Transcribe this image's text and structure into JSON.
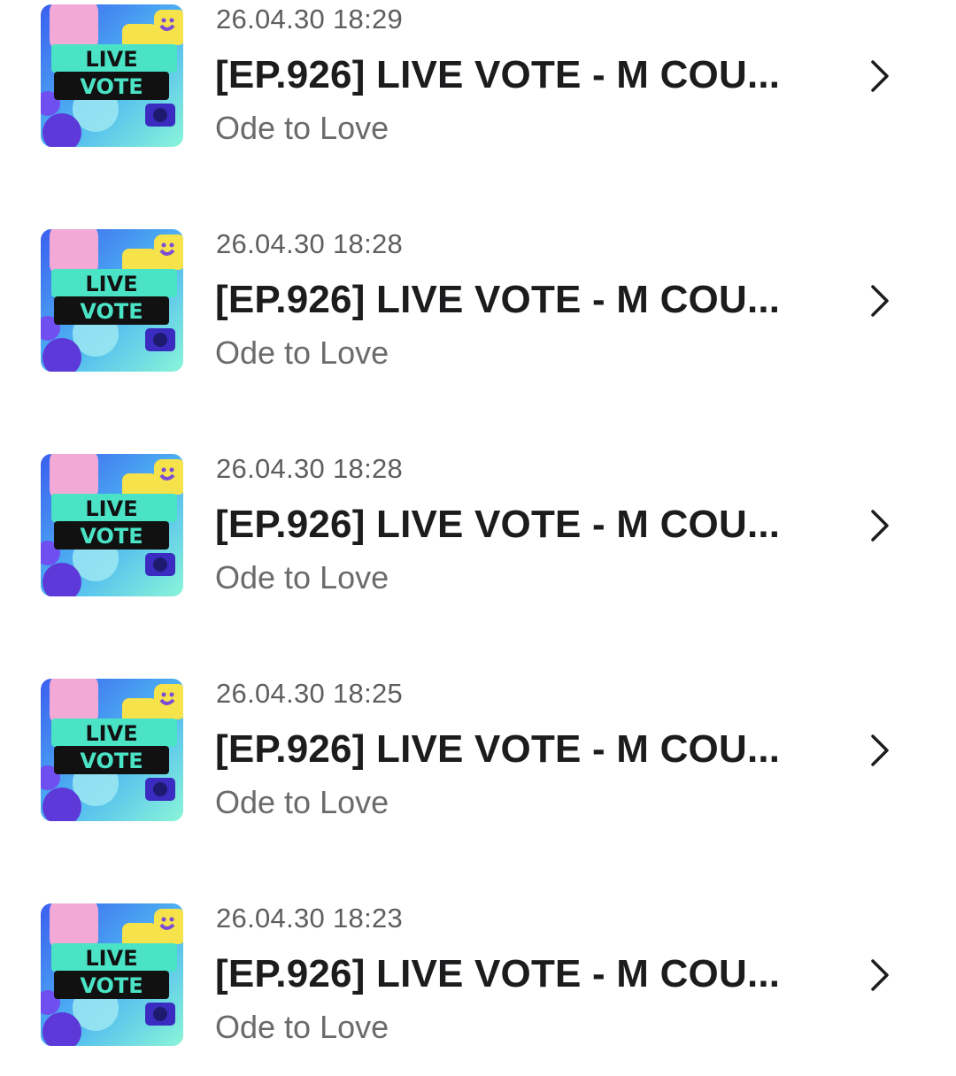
{
  "items": [
    {
      "timestamp": "26.04.30 18:29",
      "title": "[EP.926] LIVE VOTE - M COU...",
      "song": "Ode to Love",
      "thumb_line1": "LIVE",
      "thumb_line2": "VOTE",
      "thumb_icon": "live-vote-thumbnail",
      "arrow_icon": "chevron-right-icon"
    },
    {
      "timestamp": "26.04.30 18:28",
      "title": "[EP.926] LIVE VOTE - M COU...",
      "song": "Ode to Love",
      "thumb_line1": "LIVE",
      "thumb_line2": "VOTE",
      "thumb_icon": "live-vote-thumbnail",
      "arrow_icon": "chevron-right-icon"
    },
    {
      "timestamp": "26.04.30 18:28",
      "title": "[EP.926] LIVE VOTE - M COU...",
      "song": "Ode to Love",
      "thumb_line1": "LIVE",
      "thumb_line2": "VOTE",
      "thumb_icon": "live-vote-thumbnail",
      "arrow_icon": "chevron-right-icon"
    },
    {
      "timestamp": "26.04.30 18:25",
      "title": "[EP.926] LIVE VOTE - M COU...",
      "song": "Ode to Love",
      "thumb_line1": "LIVE",
      "thumb_line2": "VOTE",
      "thumb_icon": "live-vote-thumbnail",
      "arrow_icon": "chevron-right-icon"
    },
    {
      "timestamp": "26.04.30 18:23",
      "title": "[EP.926] LIVE VOTE - M COU...",
      "song": "Ode to Love",
      "thumb_line1": "LIVE",
      "thumb_line2": "VOTE",
      "thumb_icon": "live-vote-thumbnail",
      "arrow_icon": "chevron-right-icon"
    }
  ],
  "colors": {
    "title_text": "#1c1c1e",
    "meta_text": "#5e5e5e",
    "thumb_badge_green": "#4be3c6",
    "thumb_badge_black": "#111111",
    "thumb_bg_blue": "#3d6cf0",
    "thumb_bg_cyan": "#56e3e0"
  }
}
